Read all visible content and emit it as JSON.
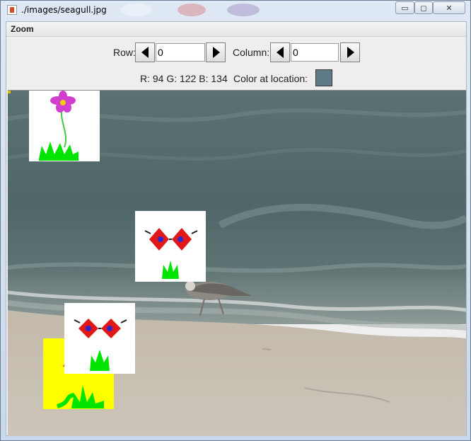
{
  "window": {
    "title": "./images/seagull.jpg",
    "minimize_glyph": "▭",
    "maximize_glyph": "◻",
    "close_glyph": "✕"
  },
  "menu": {
    "items": [
      "Zoom"
    ]
  },
  "controls": {
    "row_label": "Row:",
    "row_value": "0",
    "column_label": "Column:",
    "column_value": "0",
    "pixel_readout": "R: 94 G: 122 B: 134",
    "color_label": "Color at location:",
    "swatch_color": "#5e7a86"
  },
  "icons": {
    "row_prev": "triangle-left-icon",
    "row_next": "triangle-right-icon",
    "column_prev": "triangle-left-icon",
    "column_next": "triangle-right-icon"
  },
  "colors": {
    "sea": "#53696f",
    "sand": "#c7bfb2",
    "yellow_tile": "#ffff00",
    "flower_magenta": "#d13fcf",
    "grass_green": "#00e400",
    "eye_red": "#e01818",
    "eye_blue": "#2a2ad0"
  }
}
